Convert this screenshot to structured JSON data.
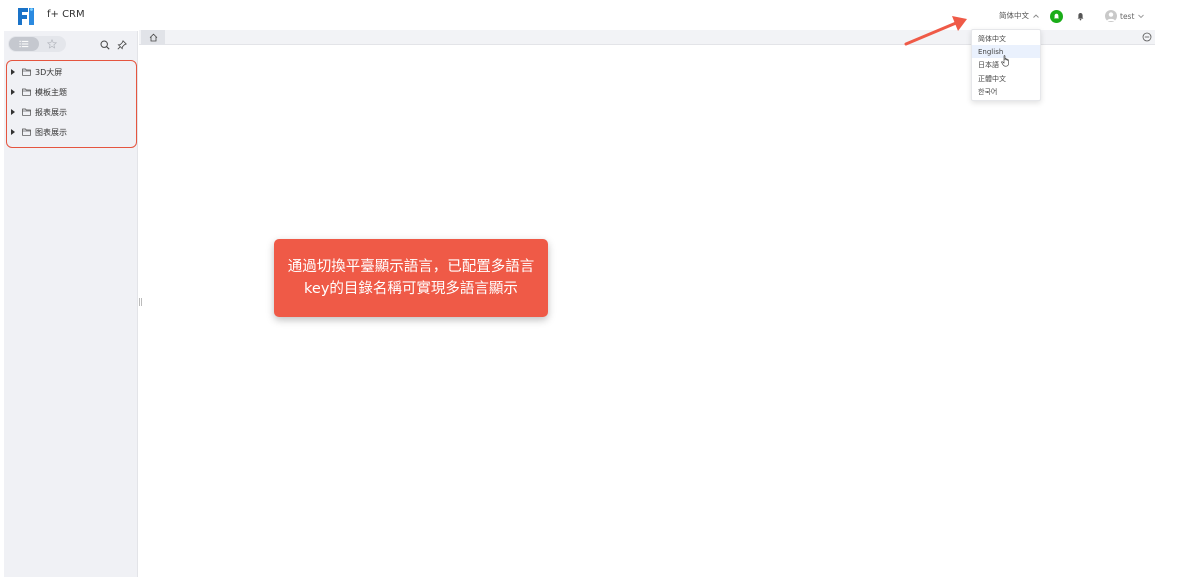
{
  "header": {
    "app_title": "f+ CRM",
    "language": "简体中文",
    "user": "test"
  },
  "sidebar": {
    "tree": [
      {
        "label": "3D大屏"
      },
      {
        "label": "模板主题"
      },
      {
        "label": "报表展示"
      },
      {
        "label": "图表展示"
      }
    ]
  },
  "language_menu": {
    "options": [
      "简体中文",
      "English",
      "日本語",
      "正體中文",
      "한국어"
    ],
    "hovered": "English"
  },
  "callout": {
    "text": "通過切換平臺顯示語言，已配置多語言key的目錄名稱可實現多語言顯示"
  },
  "colors": {
    "accent_red": "#ef5a47",
    "status_green": "#1aad19",
    "logo_blue": "#1a73c8"
  }
}
